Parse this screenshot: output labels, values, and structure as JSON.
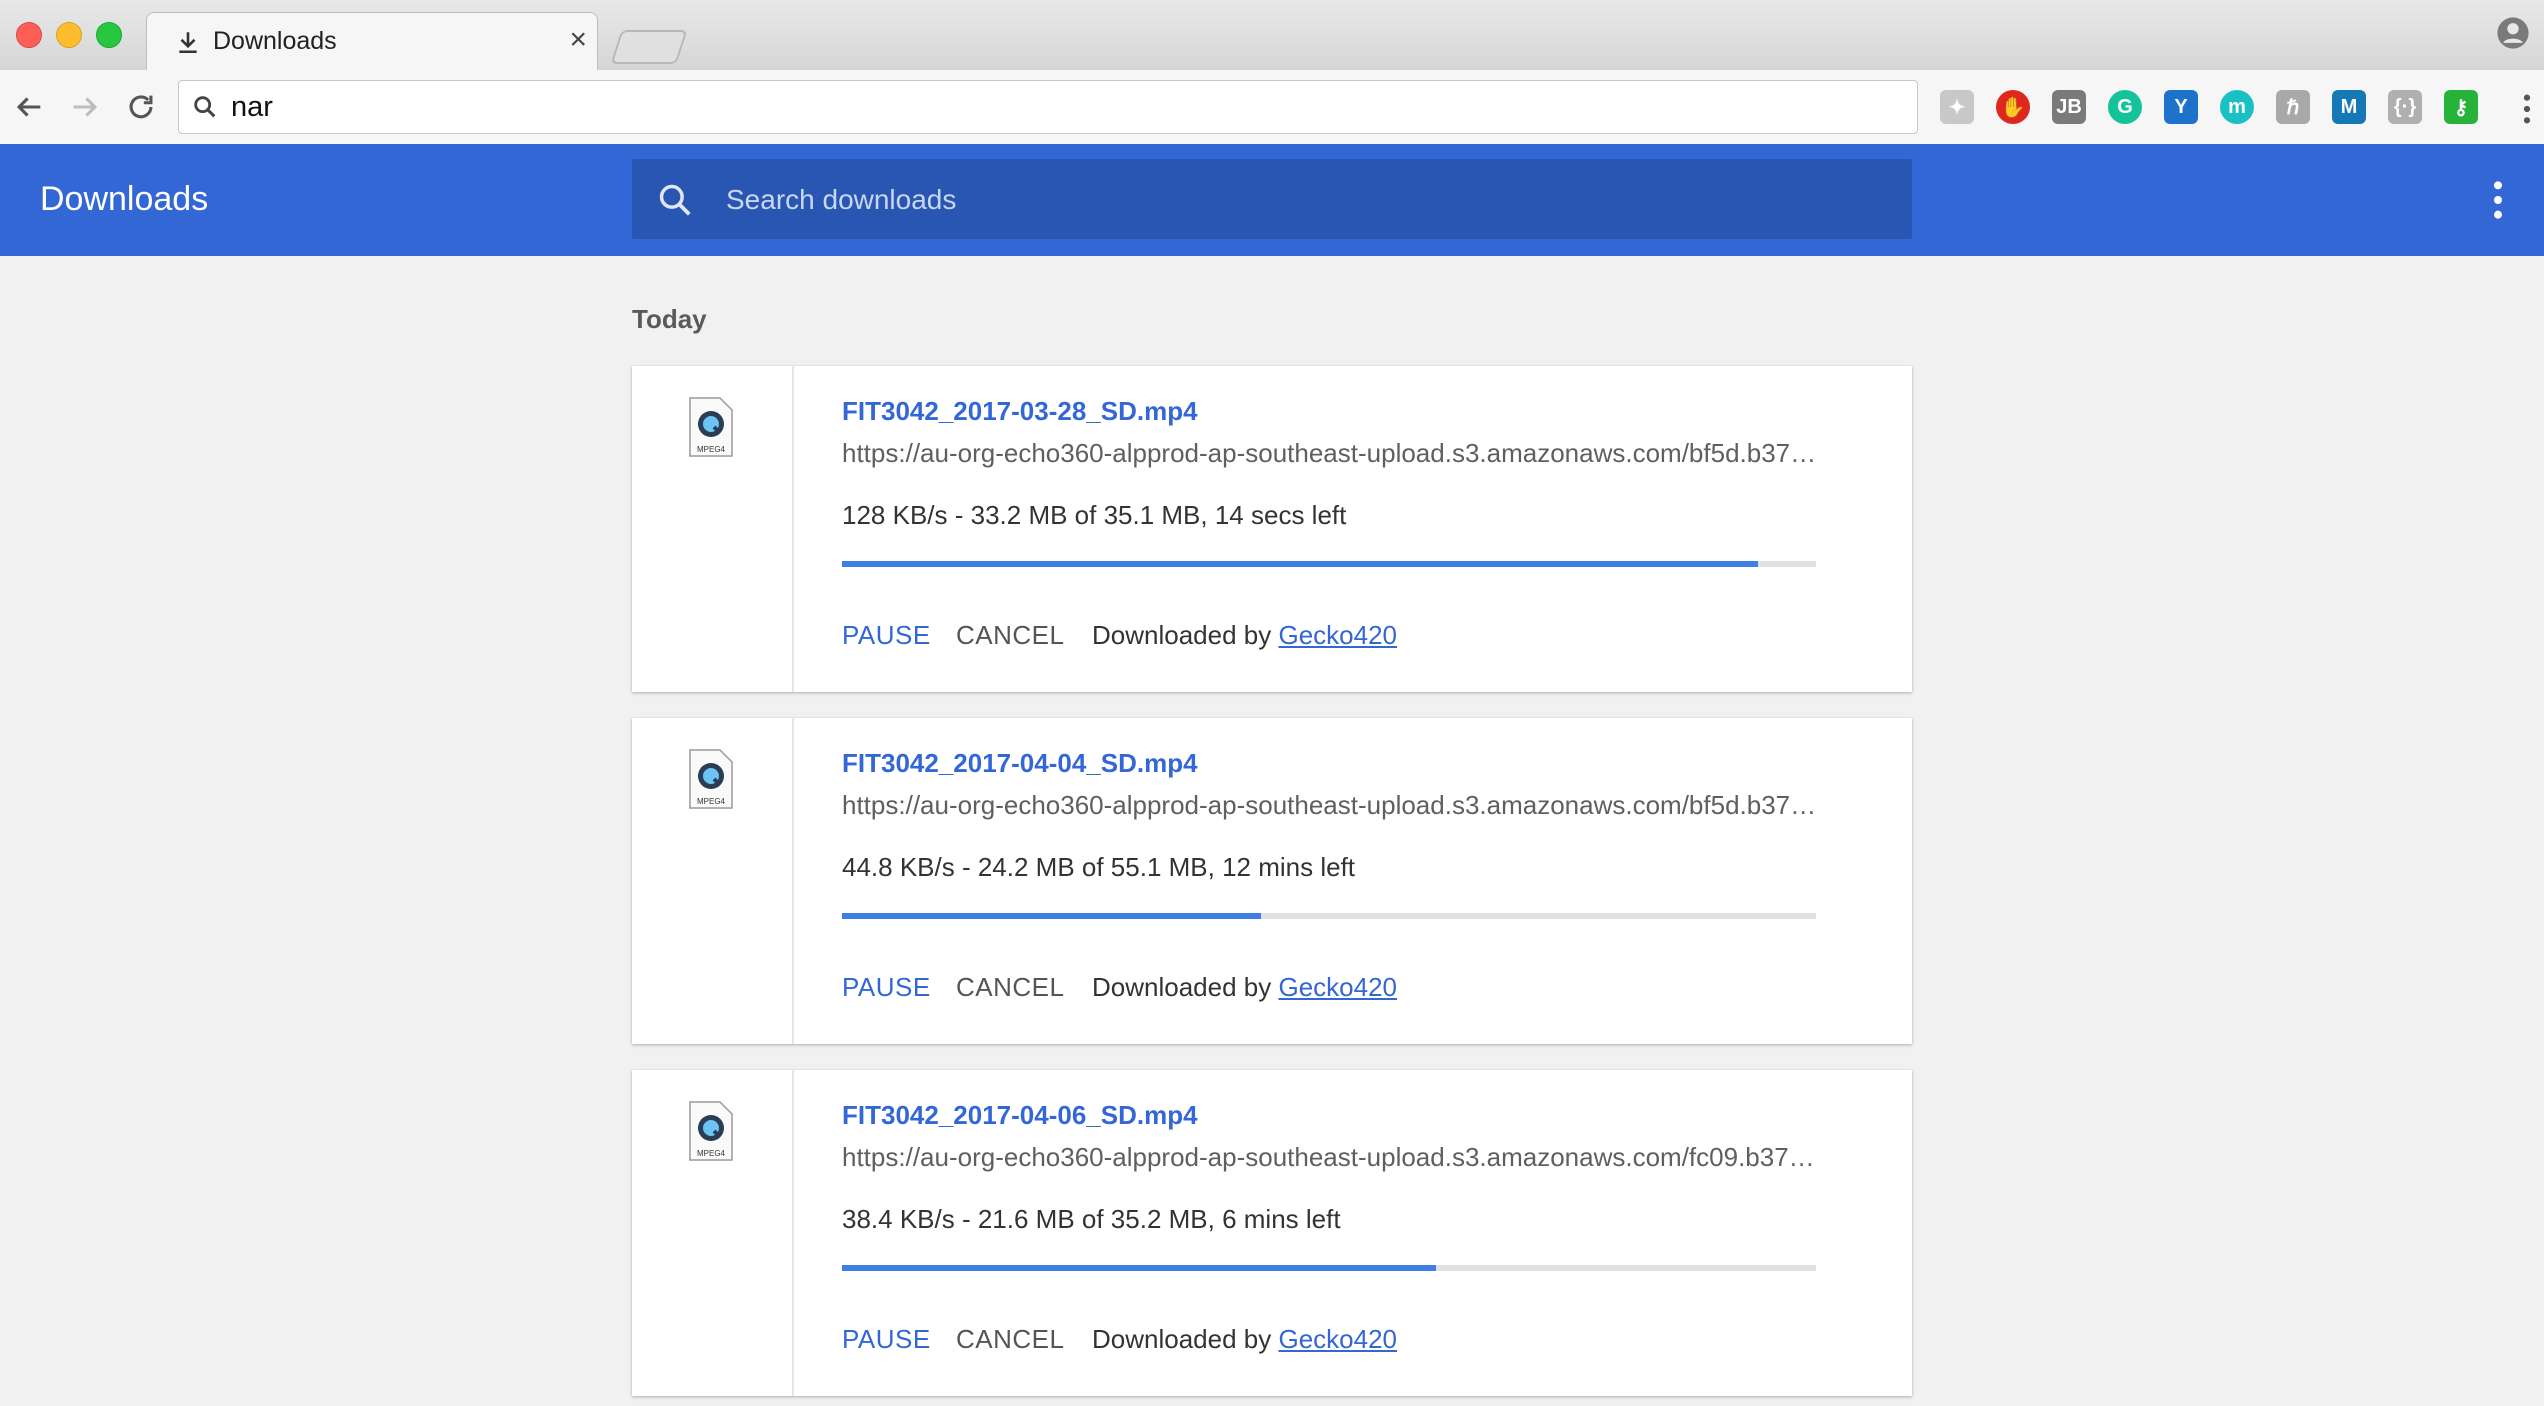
{
  "browser": {
    "tab_title": "Downloads",
    "omnibox_text": "nar"
  },
  "header": {
    "title": "Downloads",
    "search_placeholder": "Search downloads"
  },
  "section": {
    "date": "Today"
  },
  "downloads": [
    {
      "file_name": "FIT3042_2017-03-28_SD.mp4",
      "url": "https://au-org-echo360-alpprod-ap-southeast-upload.s3.amazonaws.com/bf5d.b37…",
      "status": "128 KB/s - 33.2 MB of 35.1 MB, 14 secs left",
      "progress": 0.94,
      "pause_label": "PAUSE",
      "cancel_label": "CANCEL",
      "by_label": "Downloaded by",
      "by_link": "Gecko420",
      "icon_label": "MPEG4"
    },
    {
      "file_name": "FIT3042_2017-04-04_SD.mp4",
      "url": "https://au-org-echo360-alpprod-ap-southeast-upload.s3.amazonaws.com/bf5d.b37…",
      "status": "44.8 KB/s - 24.2 MB of 55.1 MB, 12 mins left",
      "progress": 0.43,
      "pause_label": "PAUSE",
      "cancel_label": "CANCEL",
      "by_label": "Downloaded by",
      "by_link": "Gecko420",
      "icon_label": "MPEG4"
    },
    {
      "file_name": "FIT3042_2017-04-06_SD.mp4",
      "url": "https://au-org-echo360-alpprod-ap-southeast-upload.s3.amazonaws.com/fc09.b37…",
      "status": "38.4 KB/s - 21.6 MB of 35.2 MB, 6 mins left",
      "progress": 0.61,
      "pause_label": "PAUSE",
      "cancel_label": "CANCEL",
      "by_label": "Downloaded by",
      "by_link": "Gecko420",
      "icon_label": "MPEG4"
    }
  ],
  "extensions": [
    {
      "name": "puzzle-ext-icon",
      "color": "#c8c8c8",
      "glyph": "✦"
    },
    {
      "name": "stop-ext-icon",
      "color": "#e0271f",
      "glyph": "✋"
    },
    {
      "name": "jb-ext-icon",
      "color": "#7a7a7a",
      "glyph": "JB"
    },
    {
      "name": "grammarly-ext-icon",
      "color": "#15c39a",
      "glyph": "G"
    },
    {
      "name": "y-ext-icon",
      "color": "#1c73c9",
      "glyph": "Y"
    },
    {
      "name": "m-circle-ext-icon",
      "color": "#19c0c4",
      "glyph": "m"
    },
    {
      "name": "h-ext-icon",
      "color": "#a8a8a8",
      "glyph": "ℏ"
    },
    {
      "name": "m-square-ext-icon",
      "color": "#1479b5",
      "glyph": "M"
    },
    {
      "name": "code-ext-icon",
      "color": "#b0b0b0",
      "glyph": "{·}"
    },
    {
      "name": "key-ext-icon",
      "color": "#27b33a",
      "glyph": "⚷"
    }
  ],
  "colors": {
    "header_bg": "#3367d6",
    "accent": "#3367d6",
    "progress": "#3f7fe4"
  }
}
